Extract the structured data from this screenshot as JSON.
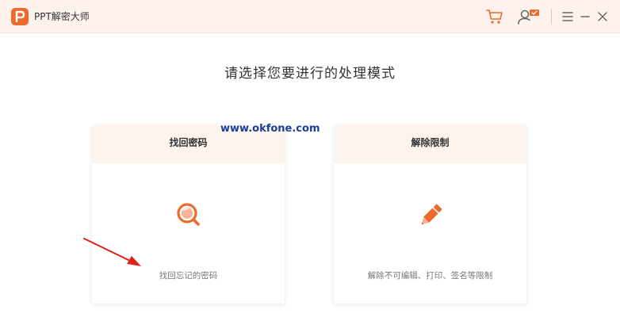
{
  "app": {
    "title": "PPT解密大师"
  },
  "header": {
    "title": "请选择您要进行的处理模式"
  },
  "watermark": "www.okfone.com",
  "cards": [
    {
      "title": "找回密码",
      "description": "找回忘记的密码",
      "icon": "search-icon"
    },
    {
      "title": "解除限制",
      "description": "解除不可编辑、打印、签名等限制",
      "icon": "pencil-icon"
    }
  ],
  "colors": {
    "accent": "#ec6a2d",
    "titlebar_bg": "#fdf3ec",
    "card_header_bg": "#fdf4ee",
    "arrow": "#e0221b",
    "watermark": "#1a3f9e"
  }
}
